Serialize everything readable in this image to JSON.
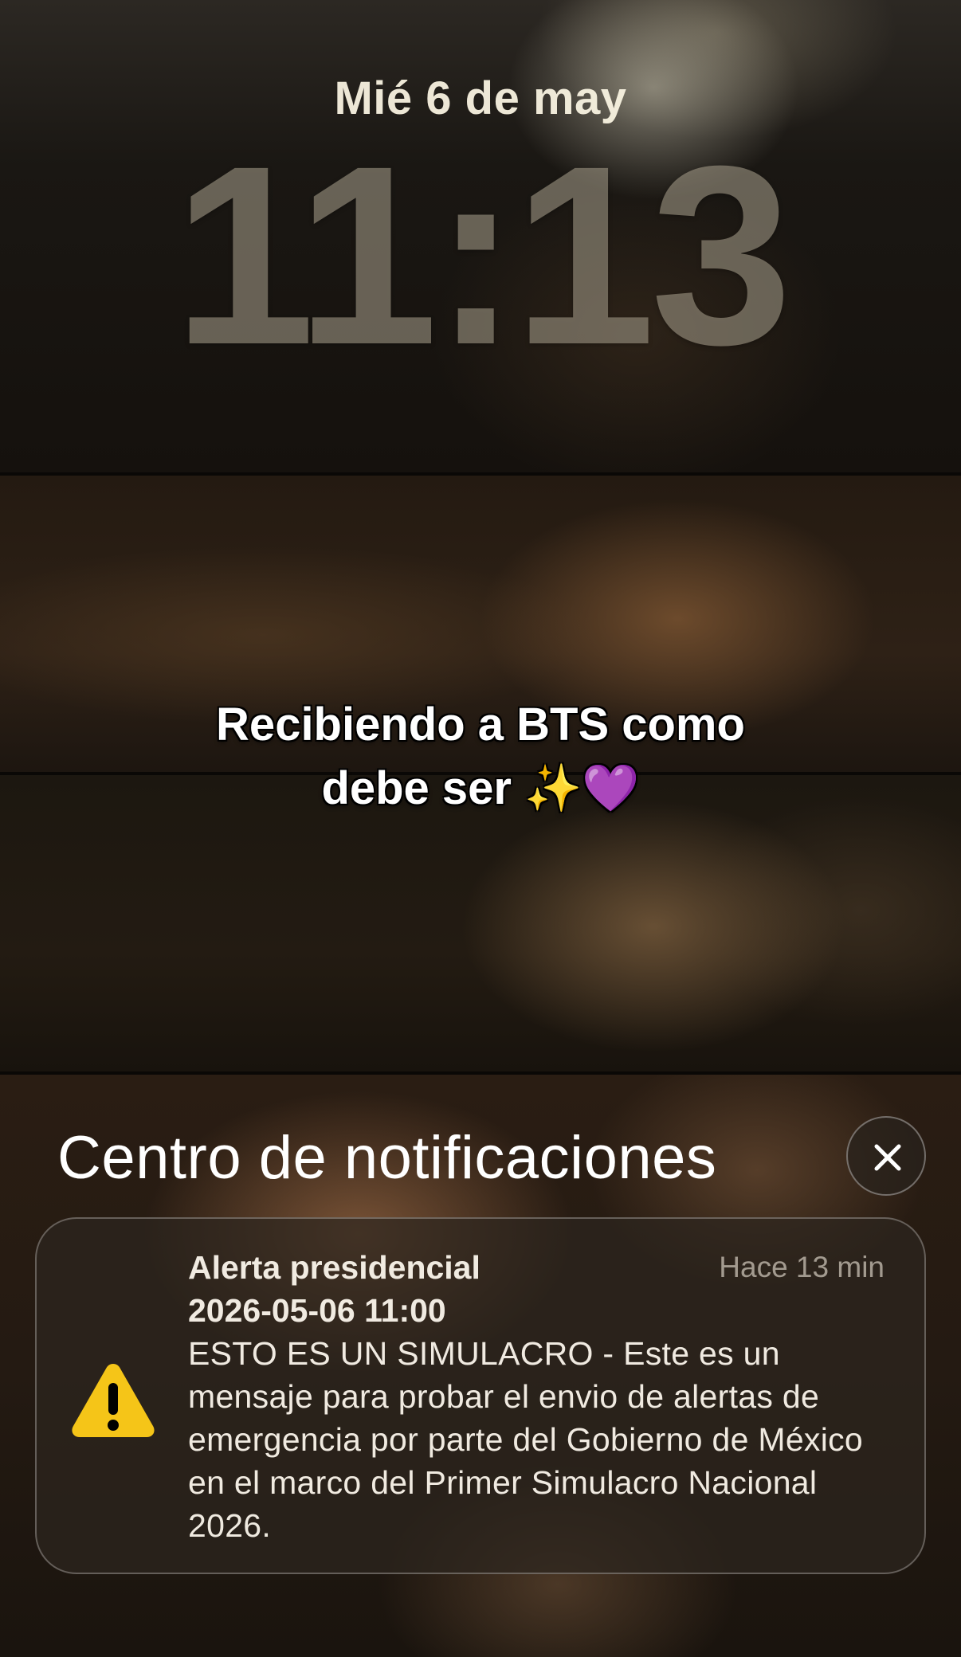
{
  "lock_screen": {
    "date": "Mié 6 de may",
    "time": "11:13"
  },
  "caption": {
    "line1": "Recibiendo a BTS como",
    "line2": "debe ser ✨💜"
  },
  "notification_center": {
    "title": "Centro de notificaciones",
    "close_icon": "close-icon",
    "notifications": [
      {
        "icon": "warning-triangle-icon",
        "title": "Alerta presidencial",
        "subtitle": "2026-05-06 11:00",
        "time": "Hace 13 min",
        "body": "ESTO ES UN SIMULACRO - Este es un mensaje para probar el envio de alertas de emergencia por parte del Gobierno de México en el marco del Primer Simulacro Nacional 2026."
      }
    ]
  },
  "colors": {
    "warning_yellow": "#f5c518",
    "text_primary": "#ffffff",
    "card_background": "#2d261f"
  }
}
